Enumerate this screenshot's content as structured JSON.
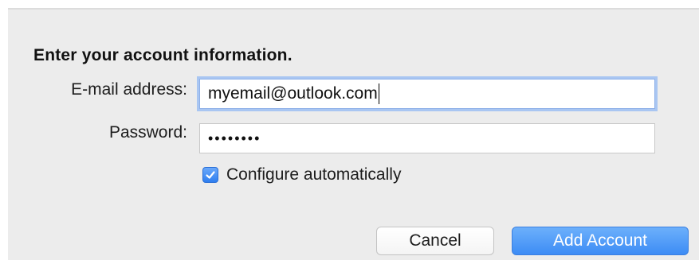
{
  "dialog": {
    "heading": "Enter your account information.",
    "email": {
      "label": "E-mail address:",
      "value": "myemail@outlook.com"
    },
    "password": {
      "label": "Password:",
      "masked_value": "••••••••"
    },
    "configure": {
      "label": "Configure automatically",
      "checked": true
    },
    "buttons": {
      "cancel": "Cancel",
      "add_account": "Add Account"
    }
  },
  "colors": {
    "accent": "#3d8cf5",
    "focus_ring": "#a9c6f2",
    "background": "#ececec"
  },
  "icons": {
    "checkbox": "checkmark-icon"
  }
}
